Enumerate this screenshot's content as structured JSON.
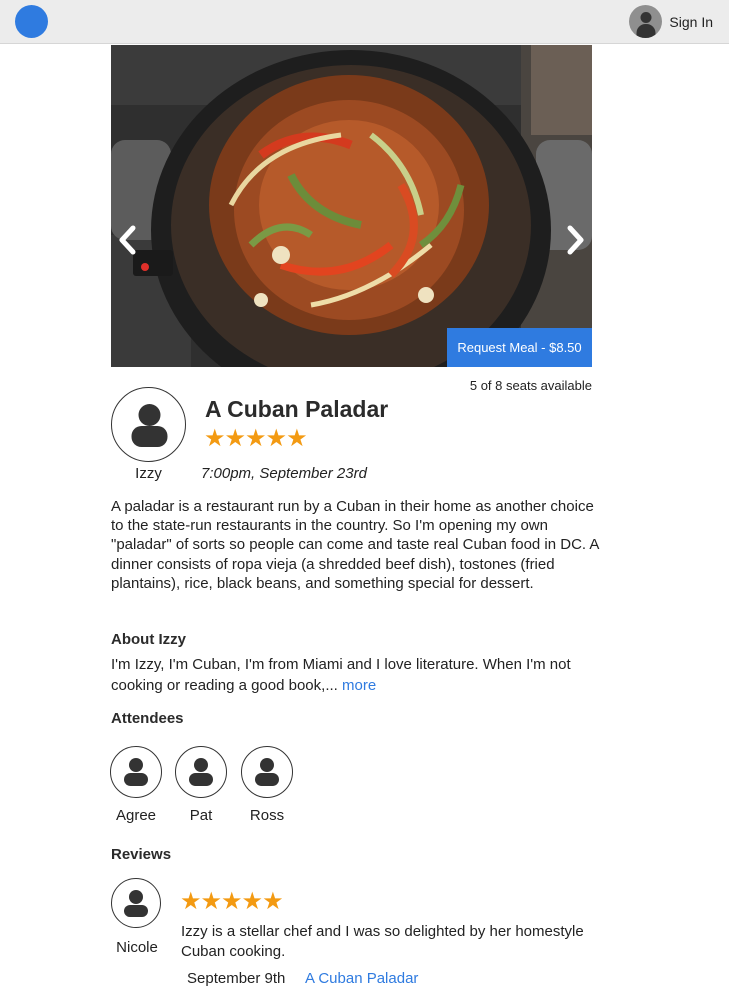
{
  "header": {
    "signin_label": "Sign In"
  },
  "meal": {
    "request_label": "Request Meal - $8.50",
    "seats_text": "5 of 8 seats available",
    "title": "A Cuban Paladar",
    "rating": 5,
    "time": "7:00pm, September 23rd",
    "description": "A paladar is a restaurant run by a Cuban in their home as another choice to the state-run restaurants in the country. So I'm opening my own \"paladar\" of sorts so people can come and taste real Cuban food in DC. A dinner consists of ropa vieja (a shredded beef dish), tostones (fried plantains), rice, black beans, and something special for dessert."
  },
  "host": {
    "name": "Izzy"
  },
  "about": {
    "heading": "About Izzy",
    "text": "I'm Izzy, I'm Cuban, I'm from Miami and I love literature. When I'm not cooking or reading a good book,... ",
    "more_label": "more"
  },
  "attendees": {
    "heading": "Attendees",
    "people": [
      {
        "name": "Agree"
      },
      {
        "name": "Pat"
      },
      {
        "name": "Ross"
      }
    ]
  },
  "reviews": {
    "heading": "Reviews",
    "items": [
      {
        "name": "Nicole",
        "rating": 5,
        "text": "Izzy is a stellar chef and I was so delighted by her homestyle Cuban cooking.",
        "date": "September 9th",
        "meal_link": "A Cuban Paladar"
      }
    ]
  },
  "colors": {
    "accent": "#2f7be0",
    "star": "#f39a12",
    "header_bg": "#ececec"
  }
}
